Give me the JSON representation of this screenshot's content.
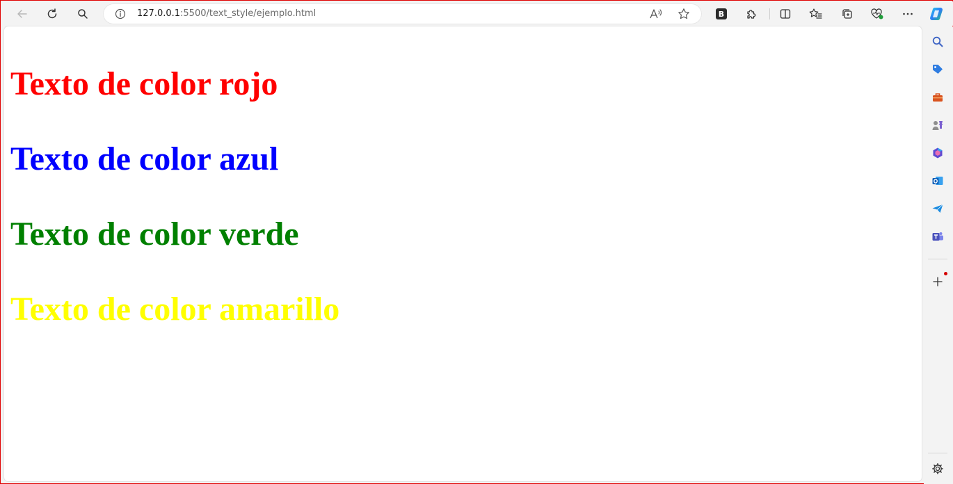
{
  "browser": {
    "url_host": "127.0.0.1",
    "url_rest": ":5500/text_style/ejemplo.html",
    "extension_badge": "B"
  },
  "page": {
    "headings": [
      {
        "text": "Texto de color rojo",
        "color": "#ff0000"
      },
      {
        "text": "Texto de color azul",
        "color": "#0000ff"
      },
      {
        "text": "Texto de color verde",
        "color": "#008000"
      },
      {
        "text": "Texto de color amarillo",
        "color": "#ffff00"
      }
    ]
  },
  "sidebar": {
    "items": [
      "search-icon",
      "shopping-tag-icon",
      "tools-icon",
      "games-icon",
      "microsoft-365-icon",
      "outlook-icon",
      "drop-icon",
      "teams-icon"
    ],
    "add_icon": "plus-icon",
    "settings_icon": "gear-icon"
  },
  "colors": {
    "window_border": "#e00000",
    "chrome_bg": "#f3f3f3"
  }
}
